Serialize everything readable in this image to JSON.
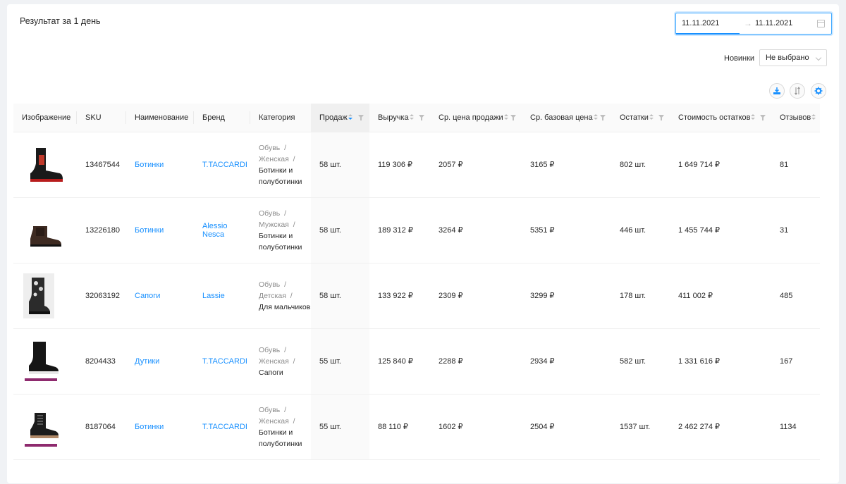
{
  "header": {
    "title": "Результат за 1 день",
    "date_from": "11.11.2021",
    "date_sep": "→",
    "date_to": "11.11.2021"
  },
  "filters": {
    "novinki_label": "Новинки",
    "novinki_value": "Не выбрано"
  },
  "accent_color": "#1890ff",
  "columns": [
    "Изображение",
    "SKU",
    "Наименование",
    "Бренд",
    "Категория",
    "Продаж",
    "Выручка",
    "Ср. цена продажи",
    "Ср. базовая цена",
    "Остатки",
    "Стоимость остатков",
    "Отзывов"
  ],
  "rows": [
    {
      "image": "boot-red-black-icon",
      "sku": "13467544",
      "name": "Ботинки",
      "brand": "T.TACCARDI",
      "cat1": "Обувь",
      "cat2": "Женская",
      "cat3": "Ботинки и полуботинки",
      "sales": "58 шт.",
      "revenue": "119 306 ₽",
      "avg_price": "2057 ₽",
      "base_price": "3165 ₽",
      "stock": "802 шт.",
      "stock_value": "1 649 714 ₽",
      "reviews": "81"
    },
    {
      "image": "boot-brown-icon",
      "sku": "13226180",
      "name": "Ботинки",
      "brand": "Alessio Nesca",
      "cat1": "Обувь",
      "cat2": "Мужская",
      "cat3": "Ботинки и полуботинки",
      "sales": "58 шт.",
      "revenue": "189 312 ₽",
      "avg_price": "3264 ₽",
      "base_price": "5351 ₽",
      "stock": "446 шт.",
      "stock_value": "1 455 744 ₽",
      "reviews": "31"
    },
    {
      "image": "boot-camo-icon",
      "sku": "32063192",
      "name": "Сапоги",
      "brand": "Lassie",
      "cat1": "Обувь",
      "cat2": "Детская",
      "cat3": "Для мальчиков",
      "sales": "58 шт.",
      "revenue": "133 922 ₽",
      "avg_price": "2309 ₽",
      "base_price": "3299 ₽",
      "stock": "178 шт.",
      "stock_value": "411 002 ₽",
      "reviews": "485"
    },
    {
      "image": "boot-tall-black-icon",
      "sku": "8204433",
      "name": "Дутики",
      "brand": "T.TACCARDI",
      "cat1": "Обувь",
      "cat2": "Женская",
      "cat3": "Сапоги",
      "sales": "55 шт.",
      "revenue": "125 840 ₽",
      "avg_price": "2288 ₽",
      "base_price": "2934 ₽",
      "stock": "582 шт.",
      "stock_value": "1 331 616 ₽",
      "reviews": "167"
    },
    {
      "image": "boot-black-laced-icon",
      "sku": "8187064",
      "name": "Ботинки",
      "brand": "T.TACCARDI",
      "cat1": "Обувь",
      "cat2": "Женская",
      "cat3": "Ботинки и полуботинки",
      "sales": "55 шт.",
      "revenue": "88 110 ₽",
      "avg_price": "1602 ₽",
      "base_price": "2504 ₽",
      "stock": "1537 шт.",
      "stock_value": "2 462 274 ₽",
      "reviews": "1134"
    }
  ]
}
